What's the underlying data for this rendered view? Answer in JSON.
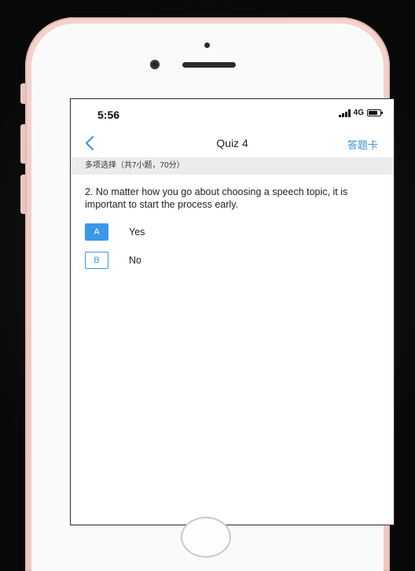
{
  "status_bar": {
    "time": "5:56",
    "network": "4G"
  },
  "nav": {
    "title": "Quiz 4",
    "answer_card": "答题卡",
    "back_icon": "chevron-left-icon"
  },
  "section": {
    "header": "多项选择（共7小题，70分）"
  },
  "question": {
    "text": "2. No matter how you go about choosing a speech topic, it is important to start the process early."
  },
  "options": [
    {
      "letter": "A",
      "text": "Yes",
      "selected": true
    },
    {
      "letter": "B",
      "text": "No",
      "selected": false
    }
  ],
  "colors": {
    "accent": "#3b97e8",
    "phone_frame": "#f3d3cd"
  }
}
